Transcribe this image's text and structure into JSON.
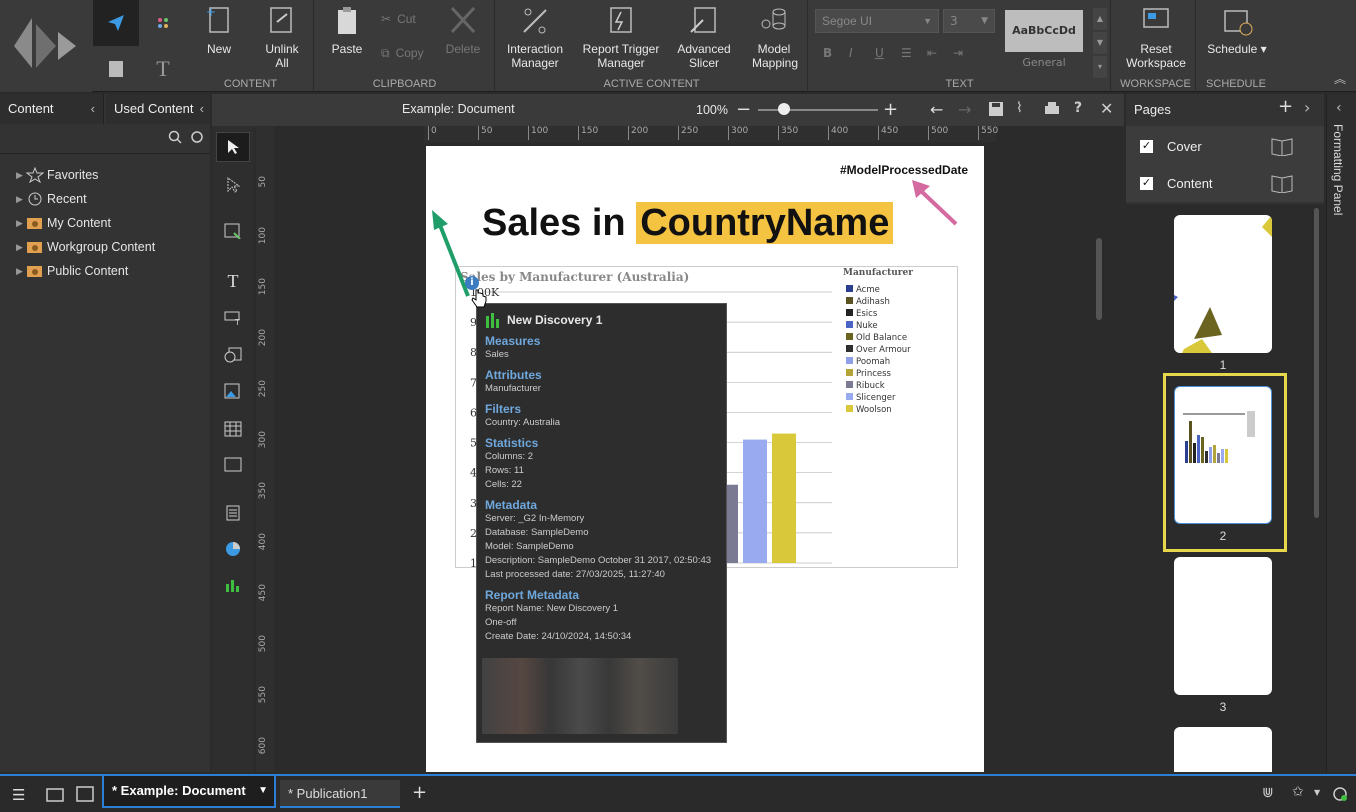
{
  "ribbon": {
    "content_group": {
      "label": "CONTENT",
      "new": "New",
      "unlink": "Unlink All"
    },
    "clipboard_group": {
      "label": "CLIPBOARD",
      "paste": "Paste",
      "cut": "Cut",
      "copy": "Copy",
      "delete": "Delete"
    },
    "active_group": {
      "label": "ACTIVE CONTENT",
      "interaction": "Interaction Manager",
      "report_trigger": "Report Trigger Manager",
      "advanced_slicer": "Advanced Slicer",
      "model_mapping": "Model Mapping"
    },
    "text_group": {
      "label": "TEXT",
      "font": "Segoe UI",
      "size": "3",
      "style_preview": "AaBbCcDd",
      "style_name": "General"
    },
    "workspace_group": {
      "label": "WORKSPACE",
      "reset": "Reset Workspace"
    },
    "schedule_group": {
      "label": "SCHEDULE",
      "schedule": "Schedule ▾"
    }
  },
  "left_panel": {
    "tab_content": "Content",
    "tab_used": "Used Content",
    "tree": [
      {
        "label": "Favorites"
      },
      {
        "label": "Recent"
      },
      {
        "label": "My Content"
      },
      {
        "label": "Workgroup Content"
      },
      {
        "label": "Public Content"
      }
    ]
  },
  "doc_bar": {
    "title": "Example: Document",
    "zoom": "100%"
  },
  "ruler": {
    "h_ticks": [
      "0",
      "50",
      "100",
      "150",
      "200",
      "250",
      "300",
      "350",
      "400",
      "450",
      "500",
      "550"
    ],
    "v_ticks": [
      "50",
      "100",
      "150",
      "200",
      "250",
      "300",
      "350",
      "400",
      "450",
      "500",
      "550",
      "600"
    ]
  },
  "page": {
    "model_processed": "#ModelProcessedDate",
    "title_prefix": "Sales in ",
    "title_highlight": "CountryName",
    "chart_title": "Sales by Manufacturer (Australia)",
    "legend_title": "Manufacturer",
    "y_label_top": "100K"
  },
  "chart_data": {
    "type": "bar",
    "title": "Sales by Manufacturer (Australia)",
    "categories": [
      "Acme",
      "Adihash",
      "Esics",
      "Nuke",
      "Old Balance",
      "Over Armour",
      "Poomah",
      "Princess",
      "Ribuck",
      "Slicenger",
      "Woolson"
    ],
    "values": [
      null,
      null,
      null,
      null,
      null,
      null,
      null,
      null,
      26,
      41,
      43
    ],
    "y_ticks": [
      "1",
      "2",
      "3",
      "4",
      "5",
      "6",
      "7",
      "8",
      "9",
      "100K"
    ],
    "colors": [
      "#2a3f8f",
      "#5a5220",
      "#222222",
      "#4a64c6",
      "#6b6420",
      "#2e2e2e",
      "#8fa0e8",
      "#b3a43a",
      "#7a7a92",
      "#9aaaf0",
      "#d9c93a"
    ],
    "legend": [
      "Acme",
      "Adihash",
      "Esics",
      "Nuke",
      "Old Balance",
      "Over Armour",
      "Poomah",
      "Princess",
      "Ribuck",
      "Slicenger",
      "Woolson"
    ]
  },
  "tooltip": {
    "title": "New Discovery 1",
    "sections": [
      {
        "h": "Measures",
        "lines": [
          "Sales"
        ]
      },
      {
        "h": "Attributes",
        "lines": [
          "Manufacturer"
        ]
      },
      {
        "h": "Filters",
        "lines": [
          "Country: Australia"
        ]
      },
      {
        "h": "Statistics",
        "lines": [
          "Columns: 2",
          "Rows: 11",
          "Cells: 22"
        ]
      },
      {
        "h": "Metadata",
        "lines": [
          "Server: _G2 In-Memory",
          "Database: SampleDemo",
          "Model: SampleDemo",
          "Description: SampleDemo October 31 2017, 02:50:43",
          "Last processed date: 27/03/2025, 11:27:40"
        ]
      },
      {
        "h": "Report Metadata",
        "lines": [
          "Report Name: New Discovery 1",
          "One-off",
          "Create Date: 24/10/2024, 14:50:34"
        ]
      }
    ]
  },
  "right_panel": {
    "title": "Pages",
    "sections": [
      {
        "label": "Cover",
        "checked": true
      },
      {
        "label": "Content",
        "checked": true
      }
    ],
    "pages": [
      "1",
      "2",
      "3"
    ]
  },
  "format_panel": {
    "label": "Formatting Panel"
  },
  "bottom": {
    "tab_active": "* Example: Document",
    "tab2": "* Publication1"
  }
}
